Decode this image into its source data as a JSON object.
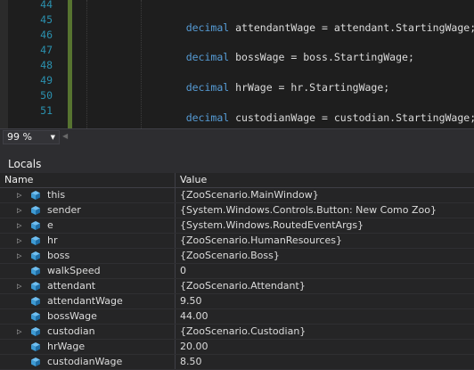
{
  "editor": {
    "line_numbers": [
      "44",
      "45",
      "46",
      "47",
      "48",
      "49",
      "50",
      "51"
    ],
    "code_lines": [
      {
        "keyword": "decimal",
        "rest": " attendantWage = attendant.StartingWage;"
      },
      {
        "keyword": "decimal",
        "rest": " bossWage = boss.StartingWage;"
      },
      {
        "keyword": "decimal",
        "rest": " hrWage = hr.StartingWage;"
      },
      {
        "keyword": "decimal",
        "rest": " custodianWage = custodian.StartingWage;"
      }
    ]
  },
  "zoom": {
    "value": "99 %"
  },
  "locals": {
    "title": "Locals",
    "columns": {
      "name": "Name",
      "value": "Value"
    },
    "rows": [
      {
        "name": "this",
        "value": "{ZooScenario.MainWindow}",
        "expandable": true
      },
      {
        "name": "sender",
        "value": "{System.Windows.Controls.Button: New Como Zoo}",
        "expandable": true
      },
      {
        "name": "e",
        "value": "{System.Windows.RoutedEventArgs}",
        "expandable": true
      },
      {
        "name": "hr",
        "value": "{ZooScenario.HumanResources}",
        "expandable": true
      },
      {
        "name": "boss",
        "value": "{ZooScenario.Boss}",
        "expandable": true
      },
      {
        "name": "walkSpeed",
        "value": "0",
        "expandable": false
      },
      {
        "name": "attendant",
        "value": "{ZooScenario.Attendant}",
        "expandable": true
      },
      {
        "name": "attendantWage",
        "value": "9.50",
        "expandable": false
      },
      {
        "name": "bossWage",
        "value": "44.00",
        "expandable": false
      },
      {
        "name": "custodian",
        "value": "{ZooScenario.Custodian}",
        "expandable": true
      },
      {
        "name": "hrWage",
        "value": "20.00",
        "expandable": false
      },
      {
        "name": "custodianWage",
        "value": "8.50",
        "expandable": false
      }
    ]
  },
  "colors": {
    "keyword": "#569cd6",
    "line_number": "#2b91af",
    "change_bar": "#577430",
    "local_icon": "#3e9bd4"
  },
  "icons": {
    "expander": "triangle-right-icon",
    "local": "local-variable-cube-icon"
  }
}
